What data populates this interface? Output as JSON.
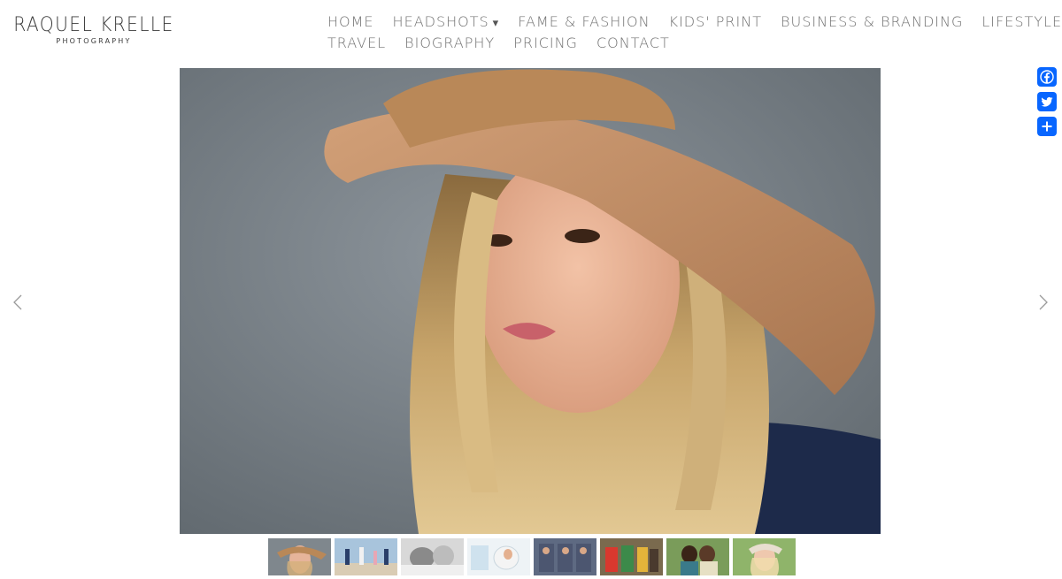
{
  "brand": {
    "name": "RAQUEL KRELLE",
    "tagline": "PHOTOGRAPHY"
  },
  "nav": {
    "row1": [
      {
        "label": "HOME",
        "has_dropdown": false
      },
      {
        "label": "HEADSHOTS",
        "has_dropdown": true
      },
      {
        "label": "FAME & FASHION",
        "has_dropdown": false
      },
      {
        "label": "KIDS' PRINT",
        "has_dropdown": false
      },
      {
        "label": "BUSINESS & BRANDING",
        "has_dropdown": false
      },
      {
        "label": "LIFESTYLE",
        "has_dropdown": false
      }
    ],
    "row2": [
      {
        "label": "TRAVEL",
        "has_dropdown": false
      },
      {
        "label": "BIOGRAPHY",
        "has_dropdown": false
      },
      {
        "label": "PRICING",
        "has_dropdown": false
      },
      {
        "label": "CONTACT",
        "has_dropdown": false
      }
    ],
    "dropdown_caret": "▾"
  },
  "share": {
    "buttons": [
      {
        "icon": "facebook-icon"
      },
      {
        "icon": "twitter-icon"
      },
      {
        "icon": "share-plus-icon"
      }
    ],
    "color": "#0866ff"
  },
  "slideshow": {
    "prev_icon": "chevron-left-icon",
    "next_icon": "chevron-right-icon",
    "thumbnail_count": 8,
    "active_thumbnail": 1
  },
  "colors": {
    "nav_text": "#707070",
    "logo_text": "#3a3a3a",
    "background": "#ffffff"
  }
}
